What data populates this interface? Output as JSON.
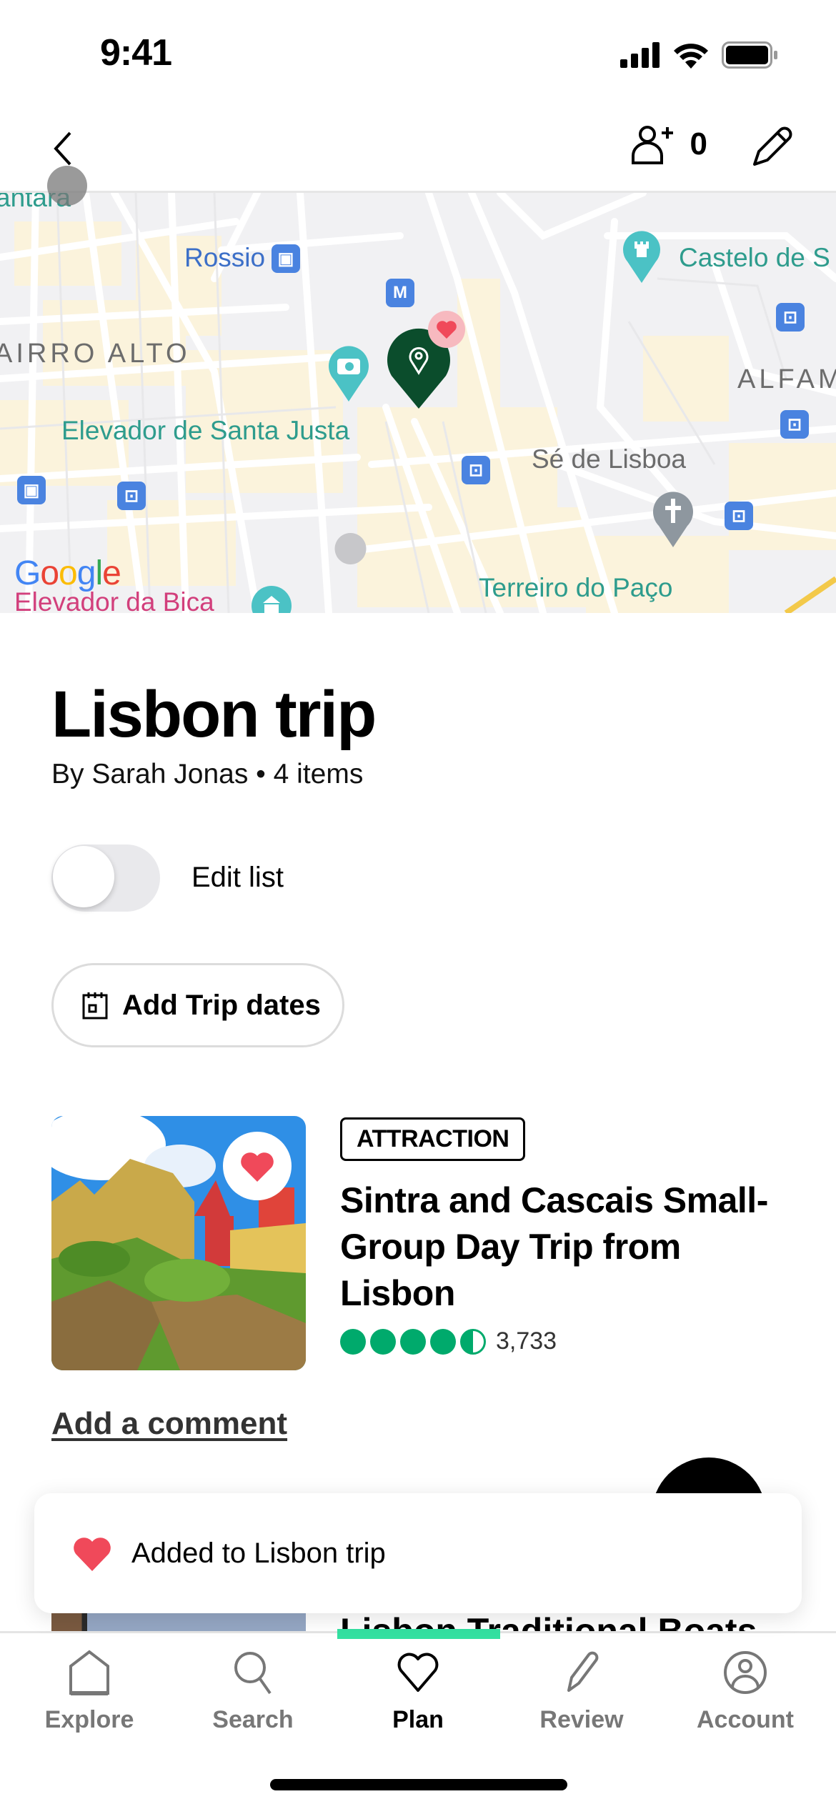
{
  "status_bar": {
    "time": "9:41"
  },
  "header": {
    "back_icon": "chevron-left-icon",
    "collaborators_count": "0",
    "add_collaborator_icon": "add-person-icon",
    "edit_icon": "pencil-icon"
  },
  "map": {
    "labels": {
      "top_clip": "antara",
      "rossio": "Rossio",
      "castelo": "Castelo de S",
      "bairro_alto": "AIRRO ALTO",
      "alfama": "ALFAM",
      "santa_justa": "Elevador de Santa Justa",
      "se_lisboa": "Sé de Lisboa",
      "bica": "Elevador da Bica",
      "terreiro": "Terreiro do Paço",
      "metro": "M"
    },
    "google_logo": "Google",
    "colors": {
      "pin": "#0b4d2c",
      "heart": "#f0495a",
      "teal": "#2e9c8d",
      "transit": "#4a83e0"
    }
  },
  "trip": {
    "title": "Lisbon trip",
    "meta": "By Sarah Jonas • 4 items",
    "edit_toggle_label": "Edit list",
    "edit_toggle_on": false,
    "add_dates_label": "Add Trip dates"
  },
  "items": [
    {
      "category": "ATTRACTION",
      "title": "Sintra and Cascais Small-Group Day Trip from Lisbon",
      "rating": 4.5,
      "review_count": "3,733",
      "saved": true,
      "comment_link": "Add a comment"
    },
    {
      "title": "Lisbon Traditional Boats"
    }
  ],
  "toast": {
    "text": "Added to Lisbon trip",
    "icon": "heart-icon"
  },
  "tab_bar": {
    "tabs": [
      {
        "label": "Explore",
        "icon": "home-icon",
        "active": false
      },
      {
        "label": "Search",
        "icon": "search-icon",
        "active": false
      },
      {
        "label": "Plan",
        "icon": "heart-icon",
        "active": true
      },
      {
        "label": "Review",
        "icon": "pencil-icon",
        "active": false
      },
      {
        "label": "Account",
        "icon": "account-icon",
        "active": false
      }
    ],
    "accent": "#34e0a1"
  }
}
